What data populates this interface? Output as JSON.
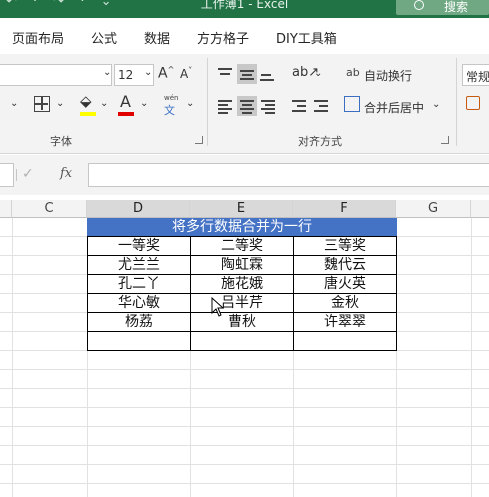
{
  "window": {
    "title": "工作薄1  -  Excel",
    "search_label": "搜索",
    "qat": "↶ · ↷ · ⌄"
  },
  "tabs": [
    "页面布局",
    "公式",
    "数据",
    "方方格子",
    "DIY工具箱"
  ],
  "ribbon": {
    "font": {
      "size_value": "12",
      "grow_icon": "A^",
      "shrink_icon": "A˅",
      "group_label": "字体",
      "fill_color": "#ffff00",
      "font_color": "#e00000",
      "phonetic_top": "wén",
      "phonetic_bottom": "文"
    },
    "alignment": {
      "wrap_label": "自动换行",
      "merge_label": "合并后居中",
      "group_label": "对齐方式"
    },
    "number": {
      "format_value": "常规"
    }
  },
  "formula_bar": {
    "cancel_icon": "✓",
    "fx_label": "fx",
    "value": ""
  },
  "columns": [
    "C",
    "D",
    "E",
    "F",
    "G"
  ],
  "sheet": {
    "header_color": "#4472c4",
    "title": "将多行数据合并为一行",
    "rows": [
      [
        "一等奖",
        "二等奖",
        "三等奖"
      ],
      [
        "尤兰兰",
        "陶虹霖",
        "魏代云"
      ],
      [
        "孔二丫",
        "施花娥",
        "唐火英"
      ],
      [
        "华心敏",
        "吕半芹",
        "金秋"
      ],
      [
        "杨荔",
        "曹秋",
        "许翠翠"
      ],
      [
        "",
        "",
        ""
      ]
    ]
  }
}
